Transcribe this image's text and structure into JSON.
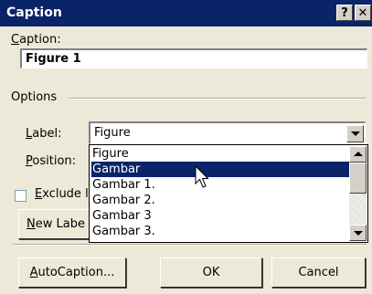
{
  "window": {
    "title": "Caption",
    "help_label": "?",
    "close_label": "✕"
  },
  "caption": {
    "label": "Caption:",
    "value": "Figure 1"
  },
  "options": {
    "title": "Options"
  },
  "label_field": {
    "label": "Label:",
    "value": "Figure"
  },
  "position_field": {
    "label": "Position:"
  },
  "exclude": {
    "label": "Exclude l"
  },
  "buttons": {
    "new_label": "New Labe",
    "autocaption": "AutoCaption...",
    "ok": "OK",
    "cancel": "Cancel"
  },
  "dropdown": {
    "items": [
      "Figure",
      "Gambar",
      "Gambar 1.",
      "Gambar 2.",
      "Gambar 3",
      "Gambar 3."
    ],
    "selected_index": 1
  },
  "colors": {
    "titlebar": "#0a246a",
    "selection": "#0a246a",
    "dialog_bg": "#ece9d8"
  },
  "icons": {
    "cursor": "mouse-pointer-icon"
  }
}
